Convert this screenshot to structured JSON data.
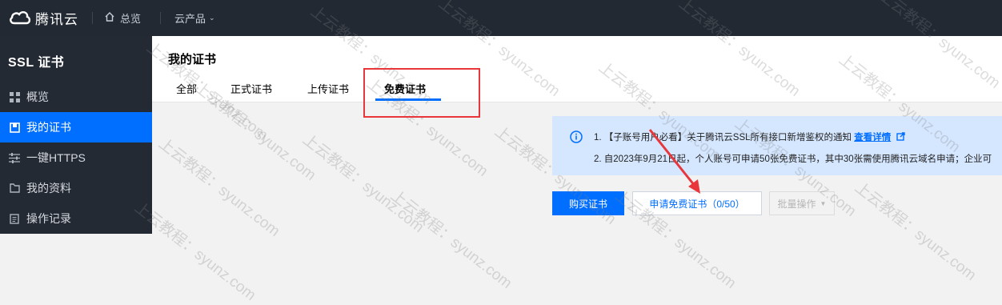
{
  "topbar": {
    "brand": "腾讯云",
    "home_label": "总览",
    "products_label": "云产品"
  },
  "sidebar": {
    "title": "SSL 证书",
    "items": [
      {
        "label": "概览",
        "icon": "grid-icon",
        "active": false
      },
      {
        "label": "我的证书",
        "icon": "certificate-icon",
        "active": true
      },
      {
        "label": "一键HTTPS",
        "icon": "sliders-icon",
        "active": false
      },
      {
        "label": "我的资料",
        "icon": "folder-icon",
        "active": false
      },
      {
        "label": "操作记录",
        "icon": "log-icon",
        "active": false
      }
    ]
  },
  "main": {
    "title": "我的证书",
    "tabs": [
      {
        "label": "全部",
        "active": false
      },
      {
        "label": "正式证书",
        "active": false
      },
      {
        "label": "上传证书",
        "active": false
      },
      {
        "label": "免费证书",
        "active": true
      }
    ],
    "notice": {
      "line1_prefix": "1. 【子账号用户必看】关于腾讯云SSL所有接口新增鉴权的通知",
      "line1_link": "查看详情",
      "line2": "2. 自2023年9月21日起，个人账号可申请50张免费证书，其中30张需使用腾讯云域名申请；企业可"
    },
    "buttons": {
      "buy": "购买证书",
      "apply_free": "申请免费证书（0/50）",
      "batch": "批量操作"
    }
  },
  "watermark": "上云教程：syunz.com",
  "colors": {
    "accent": "#006eff",
    "topbar_bg": "#222933",
    "sidebar_bg": "#232a34",
    "notice_bg": "#d5e7ff",
    "annotation": "#e8363a"
  }
}
